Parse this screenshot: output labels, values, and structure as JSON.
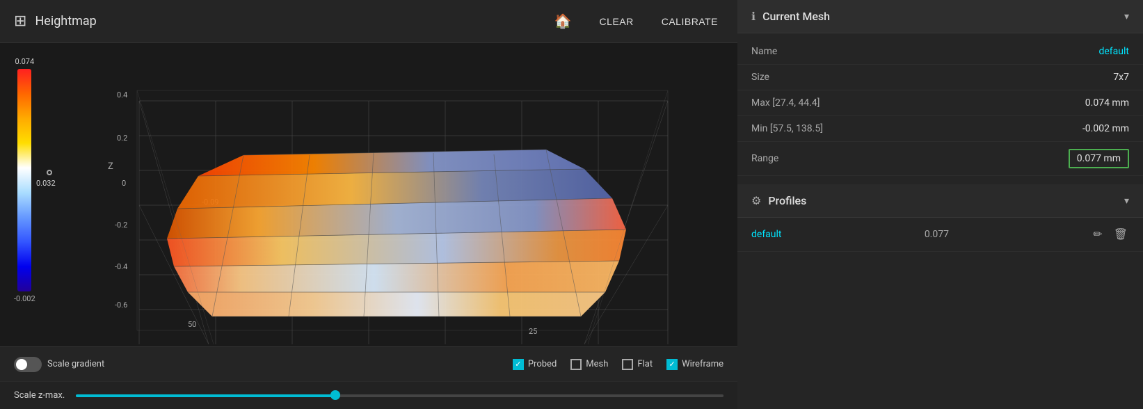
{
  "header": {
    "title": "Heightmap",
    "clear_label": "CLEAR",
    "calibrate_label": "CALIBRATE"
  },
  "gradient": {
    "top_value": "0.074",
    "mid_value": "0.032",
    "bottom_value": "-0.002"
  },
  "axis": {
    "z_label": "Z",
    "values": [
      "0.4",
      "0.2",
      "0",
      "-0.2",
      "-0.4",
      "-0.6"
    ],
    "x_values": [
      "-0.09",
      "50"
    ],
    "x2_value": "25"
  },
  "bottom_controls": {
    "scale_gradient_label": "Scale gradient",
    "probed_label": "Probed",
    "mesh_label": "Mesh",
    "flat_label": "Flat",
    "wireframe_label": "Wireframe",
    "probed_checked": true,
    "mesh_checked": false,
    "flat_checked": false,
    "wireframe_checked": true
  },
  "scale_bar": {
    "label": "Scale z-max."
  },
  "current_mesh": {
    "section_title": "Current Mesh",
    "name_label": "Name",
    "name_value": "default",
    "size_label": "Size",
    "size_value": "7x7",
    "max_label": "Max [27.4, 44.4]",
    "max_value": "0.074 mm",
    "min_label": "Min [57.5, 138.5]",
    "min_value": "-0.002 mm",
    "range_label": "Range",
    "range_value": "0.077 mm"
  },
  "profiles": {
    "section_title": "Profiles",
    "items": [
      {
        "name": "default",
        "value": "0.077"
      }
    ]
  }
}
